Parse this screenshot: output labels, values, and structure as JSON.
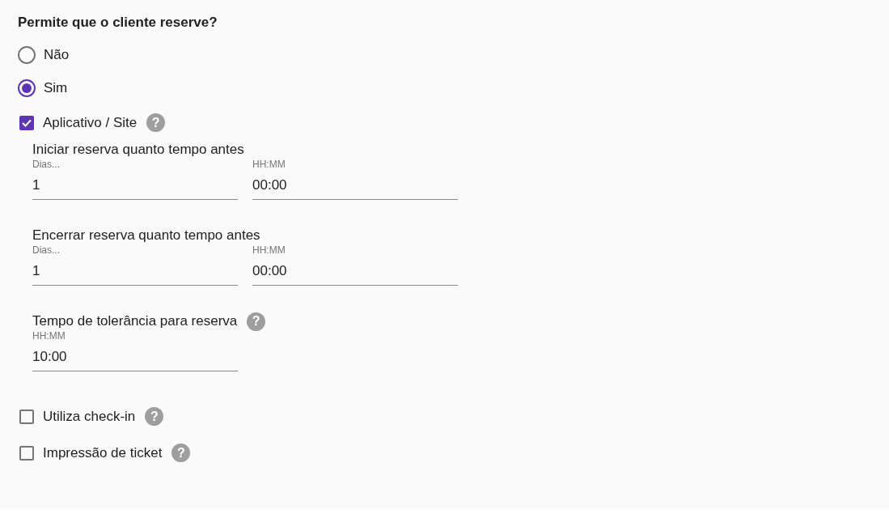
{
  "question": "Permite que o cliente reserve?",
  "options": [
    {
      "label": "Não",
      "selected": false
    },
    {
      "label": "Sim",
      "selected": true
    }
  ],
  "checkboxes": [
    {
      "label": "Aplicativo / Site",
      "checked": true,
      "help": "?",
      "sections": [
        {
          "title": "Iniciar reserva quanto tempo antes",
          "fields": [
            {
              "label": "Dias...",
              "value": "1"
            },
            {
              "label": "HH:MM",
              "value": "00:00"
            }
          ]
        },
        {
          "title": "Encerrar reserva quanto tempo antes",
          "fields": [
            {
              "label": "Dias...",
              "value": "1"
            },
            {
              "label": "HH:MM",
              "value": "00:00"
            }
          ]
        },
        {
          "title": "Tempo de tolerância para reserva",
          "help": "?",
          "fields": [
            {
              "label": "HH:MM",
              "value": "10:00"
            }
          ]
        }
      ]
    },
    {
      "label": "Utiliza check-in",
      "checked": false,
      "help": "?"
    },
    {
      "label": "Impressão de ticket",
      "checked": false,
      "help": "?"
    }
  ]
}
